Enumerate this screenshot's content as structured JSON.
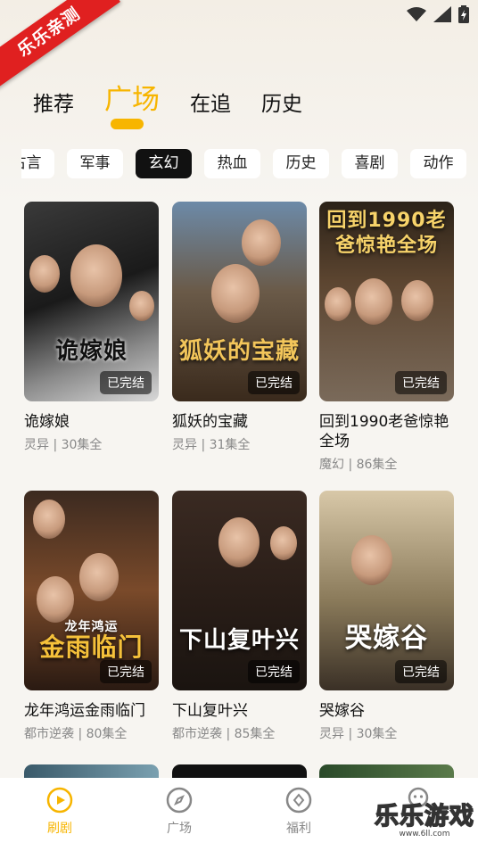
{
  "ribbon": {
    "text": "乐乐亲测"
  },
  "tabs": [
    {
      "label": "推荐"
    },
    {
      "label": "广场"
    },
    {
      "label": "在追"
    },
    {
      "label": "历史"
    }
  ],
  "active_tab": "广场",
  "categories": [
    "古言",
    "军事",
    "玄幻",
    "热血",
    "历史",
    "喜剧",
    "动作"
  ],
  "active_category": "玄幻",
  "cards": [
    {
      "title": "诡嫁娘",
      "poster_text": "诡嫁娘",
      "badge": "已完结",
      "genre": "灵异",
      "episodes": "30集全",
      "meta": "灵异 | 30集全"
    },
    {
      "title": "狐妖的宝藏",
      "poster_text": "狐妖的宝藏",
      "badge": "已完结",
      "genre": "灵异",
      "episodes": "31集全",
      "meta": "灵异 | 31集全"
    },
    {
      "title": "回到1990老爸惊艳全场",
      "poster_text": "回到1990老爸惊艳全场",
      "badge": "已完结",
      "genre": "魔幻",
      "episodes": "86集全",
      "meta": "魔幻 | 86集全"
    },
    {
      "title": "龙年鸿运金雨临门",
      "poster_text": "金雨临门",
      "poster_subtext": "龙年鸿运",
      "badge": "已完结",
      "genre": "都市逆袭",
      "episodes": "80集全",
      "meta": "都市逆袭 | 80集全"
    },
    {
      "title": "下山复叶兴",
      "poster_text": "下山复叶兴",
      "badge": "已完结",
      "genre": "都市逆袭",
      "episodes": "85集全",
      "meta": "都市逆袭 | 85集全"
    },
    {
      "title": "哭嫁谷",
      "poster_text": "哭嫁谷",
      "badge": "已完结",
      "genre": "灵异",
      "episodes": "30集全",
      "meta": "灵异 | 30集全"
    }
  ],
  "bottom_nav": [
    {
      "label": "刷剧",
      "icon": "play-circle-icon"
    },
    {
      "label": "广场",
      "icon": "compass-icon"
    },
    {
      "label": "福利",
      "icon": "coin-icon"
    },
    {
      "label": "",
      "icon": "profile-icon"
    }
  ],
  "active_nav": "刷剧",
  "watermark": {
    "main": "乐乐游戏",
    "sub": "www.6ll.com"
  },
  "colors": {
    "accent": "#f7b500",
    "active_chip_bg": "#111111",
    "ribbon": "#e02020"
  }
}
